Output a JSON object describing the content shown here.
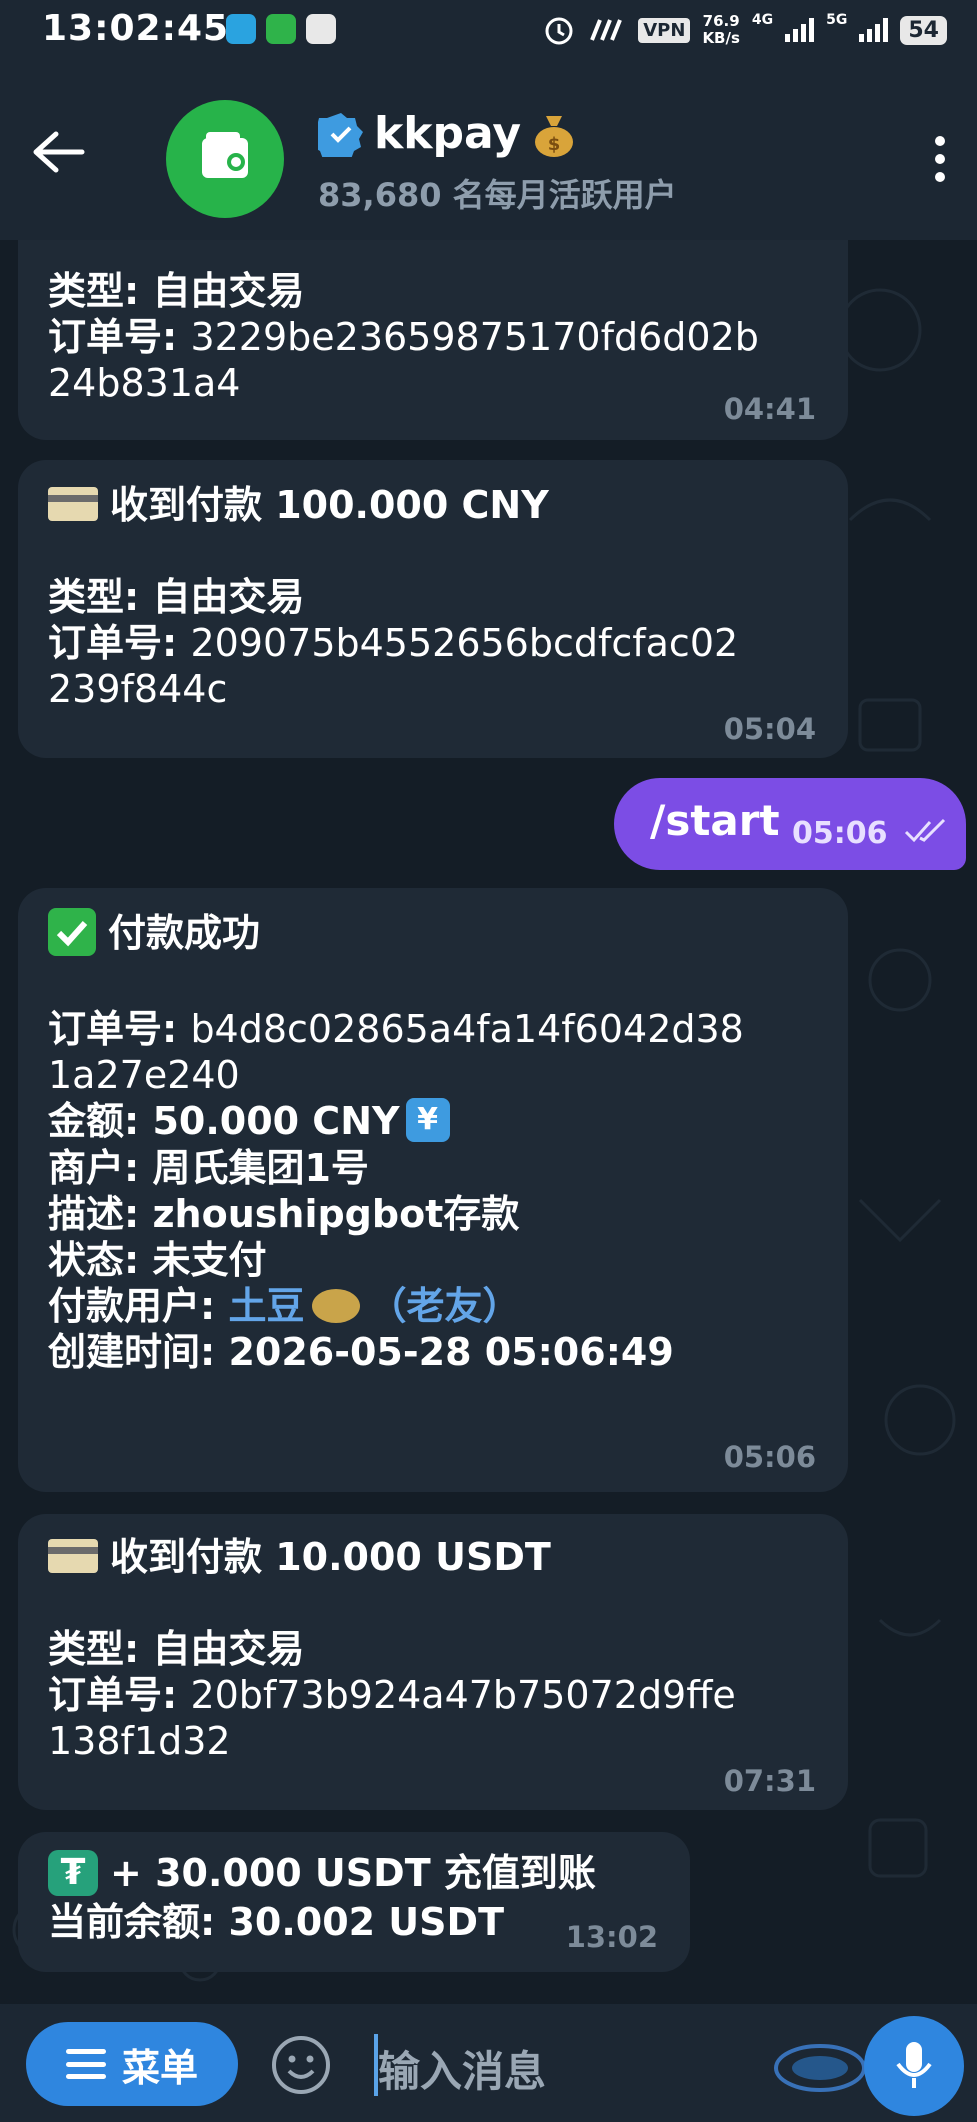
{
  "status_bar": {
    "time": "13:02:45",
    "vpn": "VPN",
    "speed_value": "76.9",
    "speed_unit": "KB/s",
    "net1": "4G",
    "net2": "5G",
    "battery": "54"
  },
  "header": {
    "title": "kkpay",
    "subtitle": "83,680 名每月活跃用户"
  },
  "messages": [
    {
      "lines": [
        {
          "k": "类型: ",
          "v": "自由交易"
        },
        {
          "k": "订单号: ",
          "v": "3229be23659875170fd6d02b"
        },
        {
          "k": "",
          "v": "24b831a4"
        }
      ],
      "time": "04:41"
    },
    {
      "head": "收到付款 100.000 CNY",
      "lines": [
        {
          "k": "类型: ",
          "v": "自由交易"
        },
        {
          "k": "订单号: ",
          "v": "209075b4552656bcdfcfac02"
        },
        {
          "k": "",
          "v": "239f844c"
        }
      ],
      "time": "05:04"
    },
    {
      "outgoing": true,
      "text": "/start",
      "time": "05:06"
    },
    {
      "head": "付款成功",
      "lines": [
        {
          "k": "订单号: ",
          "v": "b4d8c02865a4fa14f6042d38"
        },
        {
          "k": "",
          "v": "1a27e240"
        },
        {
          "k": "金额: ",
          "v": "50.000 CNY"
        },
        {
          "k": "商户: ",
          "v": "周氏集团1号"
        },
        {
          "k": "描述: ",
          "v": "zhoushipgbot存款"
        },
        {
          "k": "状态: ",
          "v": "未支付"
        },
        {
          "k": "付款用户: ",
          "v": "土豆",
          "v2": "（老友）"
        },
        {
          "k": "创建时间: ",
          "v": "2026-05-28 05:06:49"
        }
      ],
      "time": "05:06"
    },
    {
      "head": "收到付款 10.000 USDT",
      "lines": [
        {
          "k": "类型: ",
          "v": "自由交易"
        },
        {
          "k": "订单号: ",
          "v": "20bf73b924a47b75072d9ffe"
        },
        {
          "k": "",
          "v": "138f1d32"
        }
      ],
      "time": "07:31"
    },
    {
      "head": "+ 30.000 USDT 充值到账",
      "lines": [
        {
          "k": "当前余额: ",
          "v": "30.002 USDT"
        }
      ],
      "time": "13:02"
    }
  ],
  "input": {
    "menu_label": "菜单",
    "placeholder": "输入消息"
  },
  "colors": {
    "outgoing_bubble": "#7c4de5",
    "incoming_bubble": "#1f2a36",
    "accent": "#2f86df",
    "link": "#63a5e8"
  }
}
